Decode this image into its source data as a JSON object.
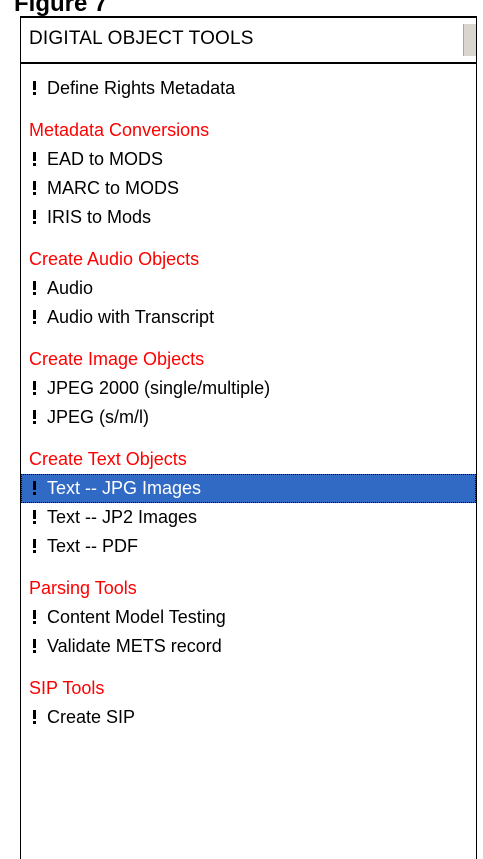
{
  "figure_label": "Figure 7",
  "header": {
    "title": "DIGITAL OBJECT TOOLS"
  },
  "list": {
    "selected_item": "Text -- JPG Images",
    "items": [
      {
        "kind": "item",
        "label": "Define Rights Metadata"
      },
      {
        "kind": "category",
        "label": "Metadata Conversions"
      },
      {
        "kind": "item",
        "label": "EAD to MODS"
      },
      {
        "kind": "item",
        "label": "MARC to MODS"
      },
      {
        "kind": "item",
        "label": "IRIS to Mods"
      },
      {
        "kind": "category",
        "label": "Create Audio Objects"
      },
      {
        "kind": "item",
        "label": "Audio"
      },
      {
        "kind": "item",
        "label": "Audio with Transcript"
      },
      {
        "kind": "category",
        "label": "Create Image Objects"
      },
      {
        "kind": "item",
        "label": "JPEG 2000 (single/multiple)"
      },
      {
        "kind": "item",
        "label": "JPEG (s/m/l)"
      },
      {
        "kind": "category",
        "label": "Create Text Objects"
      },
      {
        "kind": "item",
        "label": "Text -- JPG Images"
      },
      {
        "kind": "item",
        "label": "Text -- JP2 Images"
      },
      {
        "kind": "item",
        "label": "Text -- PDF"
      },
      {
        "kind": "category",
        "label": "Parsing Tools"
      },
      {
        "kind": "item",
        "label": "Content Model Testing"
      },
      {
        "kind": "item",
        "label": "Validate METS record"
      },
      {
        "kind": "category",
        "label": "SIP Tools"
      },
      {
        "kind": "item",
        "label": "Create SIP"
      }
    ]
  },
  "colors": {
    "category_text": "#ff0000",
    "selection_background": "#316ac5",
    "selection_text": "#ffffff"
  }
}
